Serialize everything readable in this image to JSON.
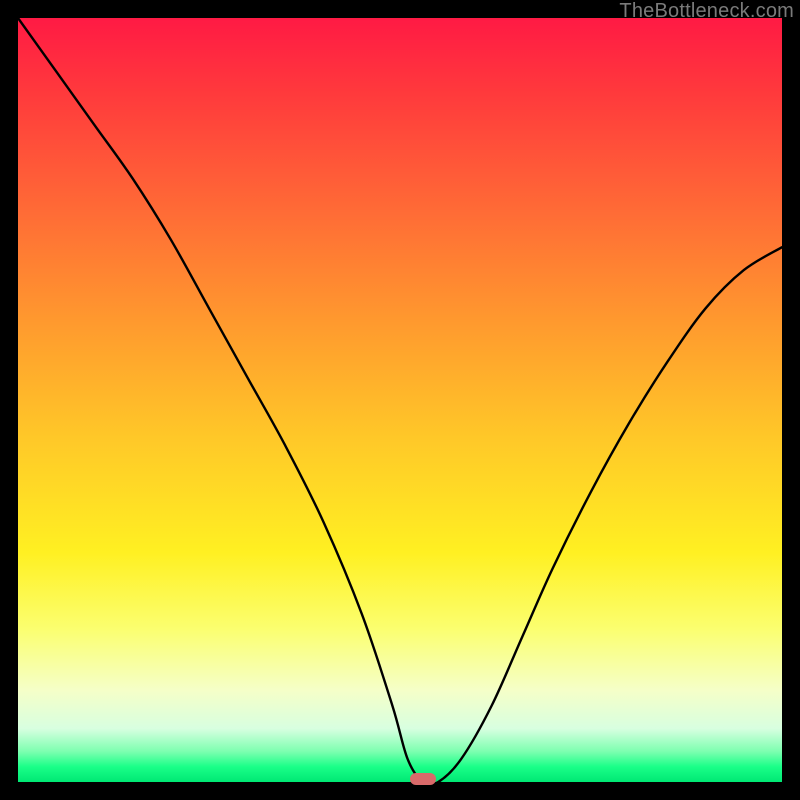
{
  "watermark": "TheBottleneck.com",
  "colors": {
    "frame": "#000000",
    "curve": "#000000",
    "min_marker": "#d96a6a",
    "gradient_top": "#ff1a44",
    "gradient_bottom": "#00e874"
  },
  "chart_data": {
    "type": "line",
    "title": "",
    "xlabel": "",
    "ylabel": "",
    "xlim": [
      0,
      100
    ],
    "ylim": [
      0,
      100
    ],
    "grid": false,
    "legend": false,
    "annotations": [
      {
        "kind": "min-marker",
        "x": 53,
        "y": 0
      }
    ],
    "series": [
      {
        "name": "bottleneck-curve",
        "x": [
          0,
          5,
          10,
          15,
          20,
          25,
          30,
          35,
          40,
          45,
          49,
          51,
          53,
          55,
          58,
          62,
          66,
          70,
          75,
          80,
          85,
          90,
          95,
          100
        ],
        "values": [
          100,
          93,
          86,
          79,
          71,
          62,
          53,
          44,
          34,
          22,
          10,
          3,
          0,
          0,
          3,
          10,
          19,
          28,
          38,
          47,
          55,
          62,
          67,
          70
        ]
      }
    ]
  }
}
